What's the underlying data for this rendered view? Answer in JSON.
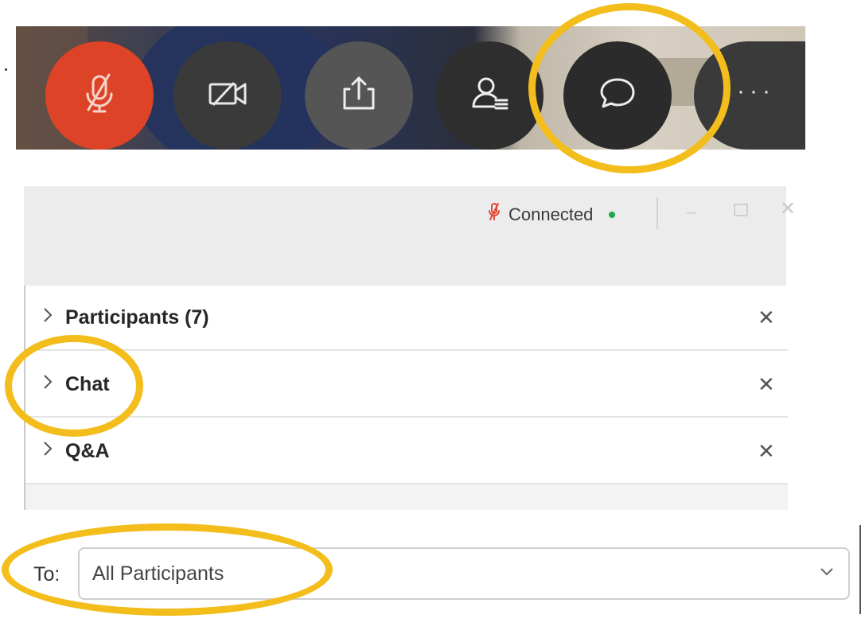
{
  "toolbar": {
    "buttons": [
      {
        "id": "mute",
        "icon": "microphone-muted-icon"
      },
      {
        "id": "video",
        "icon": "camera-off-icon"
      },
      {
        "id": "share",
        "icon": "share-screen-icon"
      },
      {
        "id": "participants",
        "icon": "participants-icon"
      },
      {
        "id": "chat",
        "icon": "chat-bubble-icon"
      },
      {
        "id": "more",
        "icon": "more-options-icon",
        "label": "···"
      }
    ]
  },
  "panel": {
    "status": {
      "text": "Connected",
      "indicator_color": "#1fa84a",
      "mic_icon": "microphone-muted-icon"
    },
    "window_controls": {
      "minimize": "–",
      "close": "✕"
    },
    "sections": [
      {
        "label": "Participants (7)"
      },
      {
        "label": "Chat"
      },
      {
        "label": "Q&A"
      }
    ],
    "close_glyph": "✕"
  },
  "chat_target": {
    "label": "To:",
    "selected": "All Participants"
  },
  "colors": {
    "highlight": "#f3bd1c",
    "mute_button": "#dd4326",
    "button_dark": "#2b2b2b"
  }
}
